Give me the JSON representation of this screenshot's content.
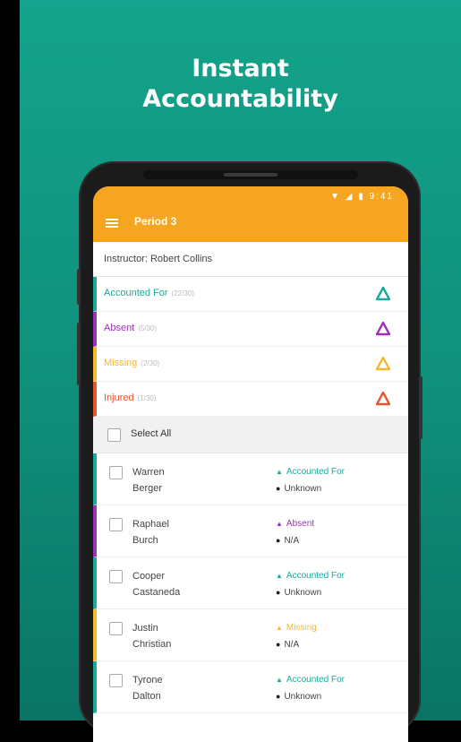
{
  "headline": {
    "line1": "Instant",
    "line2": "Accountability"
  },
  "colors": {
    "accounted": "#1aa99a",
    "absent": "#9b31b4",
    "missing": "#f5b82e",
    "injured": "#e2572b",
    "appbar": "#f5a51f"
  },
  "phone": {
    "status_icons": "▼ ◢ ▮ 9:41",
    "appbar_title": "Period 3",
    "instructor": "Instructor: Robert Collins",
    "categories": [
      {
        "label": "Accounted For",
        "count": "(22/30)",
        "color": "#1aa99a",
        "icon": "warning-icon"
      },
      {
        "label": "Absent",
        "count": "(5/30)",
        "color": "#9b31b4",
        "icon": "warning-icon"
      },
      {
        "label": "Missing",
        "count": "(2/30)",
        "color": "#f5b82e",
        "icon": "warning-icon"
      },
      {
        "label": "Injured",
        "count": "(1/30)",
        "color": "#e2572b",
        "icon": "warning-icon"
      }
    ],
    "select_all": "Select All",
    "students": [
      {
        "first": "Warren",
        "last": "Berger",
        "status": "Accounted For",
        "location": "Unknown",
        "color": "#1aa99a"
      },
      {
        "first": "Raphael",
        "last": "Burch",
        "status": "Absent",
        "location": "N/A",
        "color": "#9b31b4"
      },
      {
        "first": "Cooper",
        "last": "Castaneda",
        "status": "Accounted For",
        "location": "Unknown",
        "color": "#1aa99a"
      },
      {
        "first": "Justin",
        "last": "Christian",
        "status": "Missing",
        "location": "N/A",
        "color": "#f5b82e"
      },
      {
        "first": "Tyrone",
        "last": "Dalton",
        "status": "Accounted For",
        "location": "Unknown",
        "color": "#1aa99a"
      }
    ]
  }
}
